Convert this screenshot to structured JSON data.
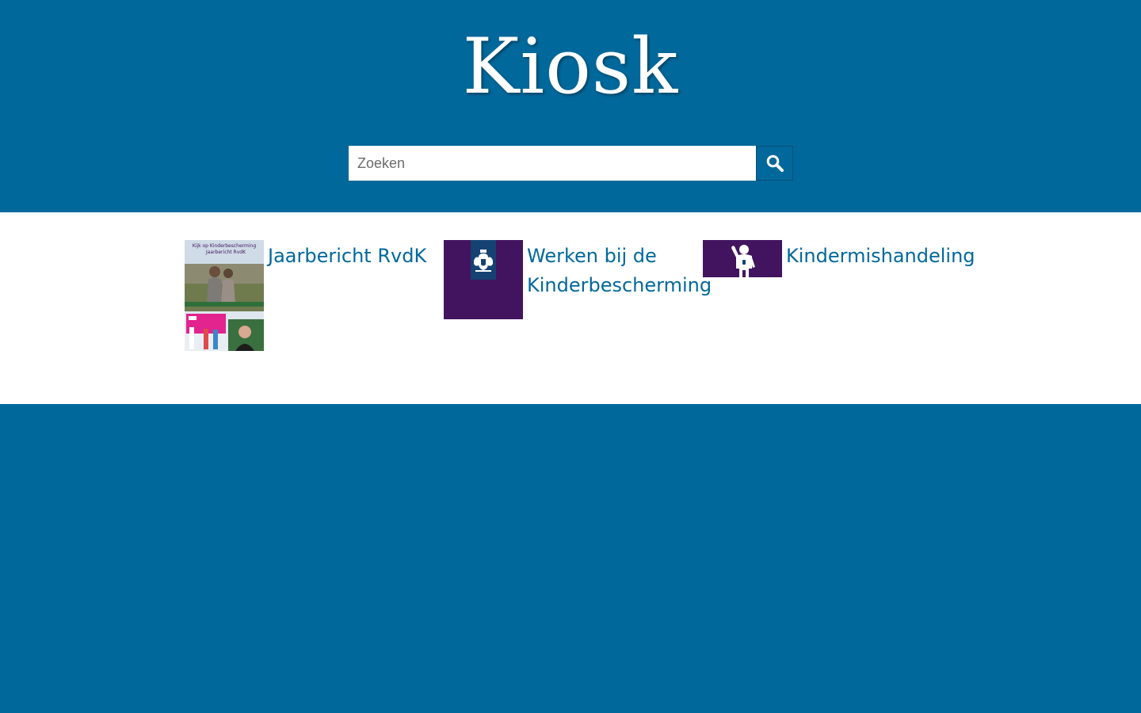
{
  "header": {
    "logo_text": "Kiosk",
    "background_color": "#01689b"
  },
  "search": {
    "placeholder": "Zoeken",
    "value": "",
    "button_icon": "search-icon"
  },
  "tiles": [
    {
      "label": "Jaarbericht RvdK",
      "thumbnail": "annual-report-cover",
      "thumbnail_text": [
        "Kijk op Kinderbescherming",
        "Jaarbericht RvdK"
      ]
    },
    {
      "label_line1": "Werken bij de",
      "label_line2": "Kinderbescherming",
      "thumbnail": "rijksoverheid-logo"
    },
    {
      "label": "Kindermishandeling",
      "thumbnail": "child-figure-banner"
    }
  ],
  "colors": {
    "link": "#01689b",
    "purple": "#42145f",
    "navy": "#154273"
  }
}
